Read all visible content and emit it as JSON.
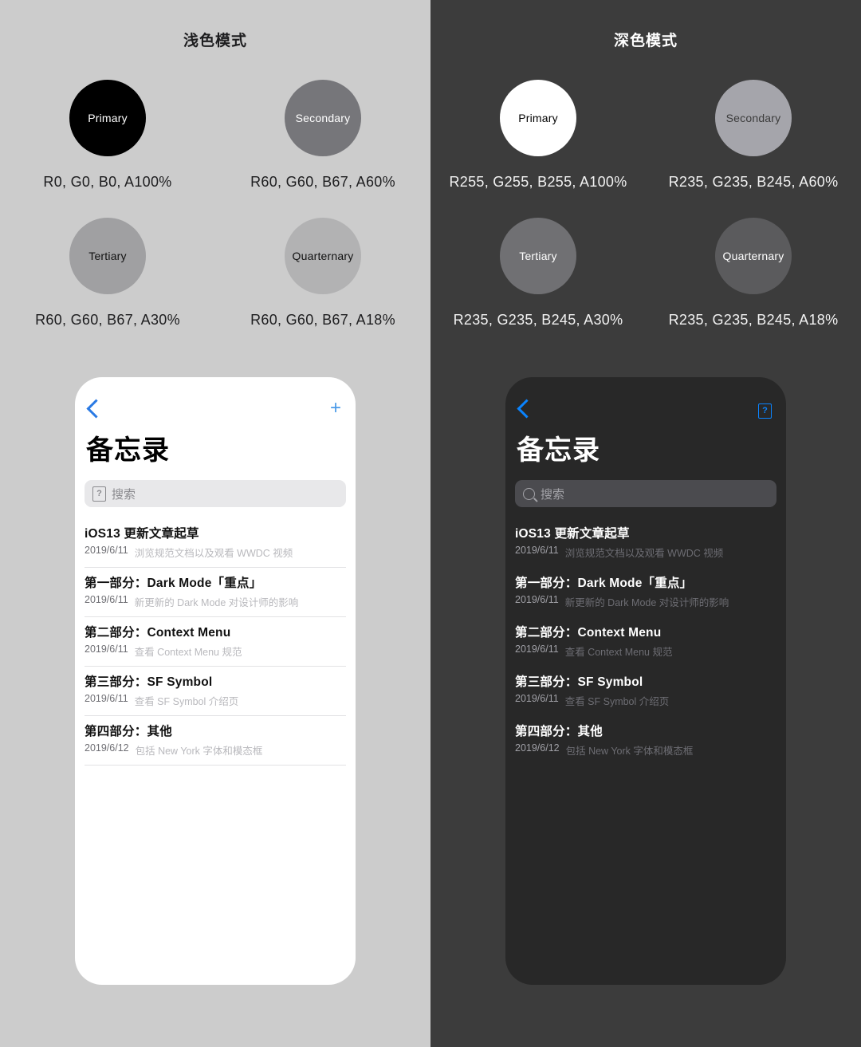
{
  "light": {
    "pane_title": "浅色模式",
    "bg": "#cccccc",
    "swatches": [
      {
        "name": "Primary",
        "label": "R0, G0, B0, A100%",
        "fill": "rgba(0,0,0,1)",
        "text": "#ffffff"
      },
      {
        "name": "Secondary",
        "label": "R60, G60, B67, A60%",
        "fill": "rgba(60,60,67,0.60)",
        "text": "#ffffff"
      },
      {
        "name": "Tertiary",
        "label": "R60, G60, B67, A30%",
        "fill": "rgba(60,60,67,0.30)",
        "text": "#111111"
      },
      {
        "name": "Quarternary",
        "label": "R60, G60, B67, A18%",
        "fill": "rgba(60,60,67,0.18)",
        "text": "#111111"
      }
    ],
    "phone": {
      "back_icon": "chevron-left-icon",
      "action_icon": "plus-icon",
      "action_glyph": "+",
      "title": "备忘录",
      "search_placeholder": "搜索",
      "search_icon": "missing-glyph-tofu-icon",
      "search_glyph": "?",
      "notes": [
        {
          "title": "iOS13 更新文章起草",
          "date": "2019/6/11",
          "desc": "浏览规范文档以及观看 WWDC 视频"
        },
        {
          "title": "第一部分：Dark Mode「重点」",
          "date": "2019/6/11",
          "desc": "新更新的 Dark Mode 对设计师的影响"
        },
        {
          "title": "第二部分：Context Menu",
          "date": "2019/6/11",
          "desc": "查看 Context Menu 规范"
        },
        {
          "title": "第三部分：SF Symbol",
          "date": "2019/6/11",
          "desc": "查看 SF Symbol 介绍页"
        },
        {
          "title": "第四部分：其他",
          "date": "2019/6/12",
          "desc": "包括 New York 字体和模态框"
        }
      ]
    }
  },
  "dark": {
    "pane_title": "深色模式",
    "bg": "#3c3c3c",
    "swatches": [
      {
        "name": "Primary",
        "label": "R255, G255, B255, A100%",
        "fill": "rgba(255,255,255,1)",
        "text": "#000000"
      },
      {
        "name": "Secondary",
        "label": "R235, G235, B245, A60%",
        "fill": "rgba(235,235,245,0.60)",
        "text": "#3c3c3c"
      },
      {
        "name": "Tertiary",
        "label": "R235, G235, B245, A30%",
        "fill": "rgba(235,235,245,0.30)",
        "text": "#ffffff"
      },
      {
        "name": "Quarternary",
        "label": "R235, G235, B245, A18%",
        "fill": "rgba(235,235,245,0.18)",
        "text": "#ffffff"
      }
    ],
    "phone": {
      "back_icon": "chevron-left-icon",
      "action_icon": "missing-glyph-tofu-icon",
      "action_glyph": "?",
      "title": "备忘录",
      "search_placeholder": "搜索",
      "search_icon": "magnifier-icon",
      "notes": [
        {
          "title": "iOS13 更新文章起草",
          "date": "2019/6/11",
          "desc": "浏览规范文档以及观看 WWDC 视频"
        },
        {
          "title": "第一部分：Dark Mode「重点」",
          "date": "2019/6/11",
          "desc": "新更新的 Dark Mode 对设计师的影响"
        },
        {
          "title": "第二部分：Context Menu",
          "date": "2019/6/11",
          "desc": "查看 Context Menu 规范"
        },
        {
          "title": "第三部分：SF Symbol",
          "date": "2019/6/11",
          "desc": "查看 SF Symbol 介绍页"
        },
        {
          "title": "第四部分：其他",
          "date": "2019/6/12",
          "desc": "包括 New York 字体和模态框"
        }
      ]
    }
  },
  "accent": "#0a84ff"
}
